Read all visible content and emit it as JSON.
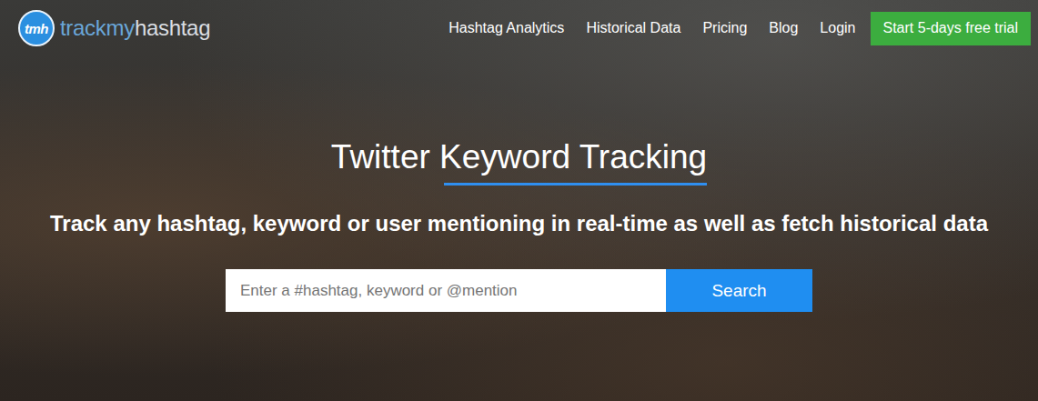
{
  "header": {
    "logo": {
      "mark": "tmh",
      "name_first": "trackmy",
      "name_second": "hashtag"
    },
    "nav": [
      {
        "label": "Hashtag Analytics"
      },
      {
        "label": "Historical Data"
      },
      {
        "label": "Pricing"
      },
      {
        "label": "Blog"
      },
      {
        "label": "Login"
      }
    ],
    "cta": "Start 5-days free trial"
  },
  "hero": {
    "title": "Twitter Keyword Tracking",
    "subtitle": "Track any hashtag, keyword or user mentioning in real-time as well as fetch historical data",
    "search": {
      "placeholder": "Enter a #hashtag, keyword or @mention",
      "button": "Search"
    }
  }
}
